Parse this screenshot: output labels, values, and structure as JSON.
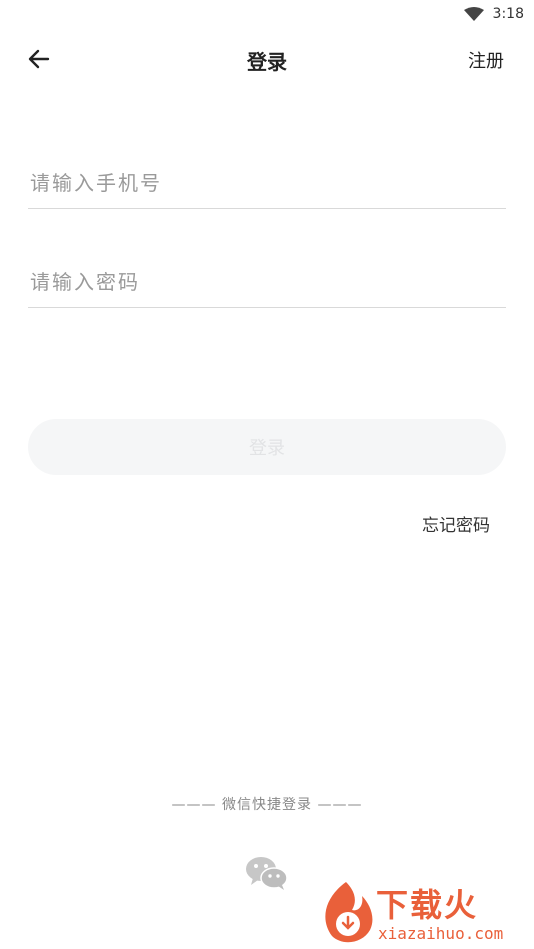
{
  "status_bar": {
    "time": "3:18"
  },
  "header": {
    "title": "登录",
    "register_label": "注册"
  },
  "form": {
    "phone_placeholder": "请输入手机号",
    "password_placeholder": "请输入密码",
    "login_label": "登录",
    "forgot_label": "忘记密码"
  },
  "social": {
    "divider_label": "——— 微信快捷登录 ———",
    "icon": "wechat-icon"
  },
  "watermark": {
    "brand": "下载火",
    "domain": "xiazaihuo.com"
  },
  "colors": {
    "accent": "#e8532a",
    "button_bg": "#f5f6f7",
    "placeholder": "#9a9a9a"
  }
}
